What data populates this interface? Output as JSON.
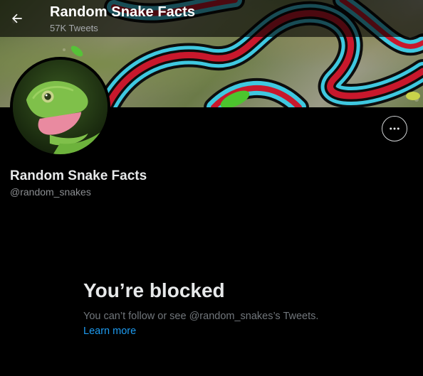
{
  "header": {
    "title": "Random Snake Facts",
    "tweet_count": "57K Tweets"
  },
  "profile": {
    "display_name": "Random Snake Facts",
    "handle": "@random_snakes"
  },
  "blocked": {
    "title": "You’re blocked",
    "message": "You can’t follow or see @random_snakes’s Tweets.",
    "link_label": "Learn more"
  },
  "colors": {
    "background": "#000000",
    "link": "#1d9bf0",
    "muted_text": "#71767b"
  }
}
